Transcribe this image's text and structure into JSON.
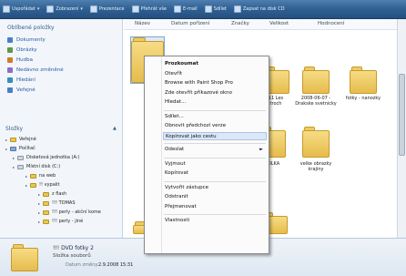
{
  "toolbar": {
    "items": [
      "Uspořádat",
      "Zobrazení",
      "Prezentace",
      "Přehrát vše",
      "E-mail",
      "Sdílet",
      "Zapsat na disk CD"
    ]
  },
  "left_pane": {
    "favorites_heading": "Oblíbené položky",
    "favorites": [
      "Dokumenty",
      "Obrázky",
      "Hudba",
      "Nedávno změněné",
      "Hledání",
      "Veřejné"
    ],
    "tree_heading": "Složky",
    "tree": [
      "Veřejné",
      "Počítač",
      "Disketová jednotka (A:)",
      "Místní disk (C:)",
      "na web",
      "!! vypalit",
      "z flash",
      "!!! TOMAS",
      "!!! perly - akční kome",
      "!!! perly - jiné"
    ]
  },
  "columns": [
    "Název",
    "Datum pořízení",
    "Značky",
    "Velikost",
    "Hodnocení"
  ],
  "files": [
    {
      "label": "11 Les\ntroch",
      "variant": "photo"
    },
    {
      "label": "2008-06-07 -\nDrakske svetnicky",
      "variant": "photo"
    },
    {
      "label": "fotky - nanozky",
      "variant": "photo"
    },
    {
      "label": "KOLKA",
      "variant": "plain"
    },
    {
      "label": "velke obrazky\nkrajiny",
      "variant": "plain"
    }
  ],
  "context_menu": {
    "items": [
      {
        "label": "Prozkoumat",
        "bold": true
      },
      {
        "label": "Otevřít"
      },
      {
        "label": "Browse with Paint Shop Pro"
      },
      {
        "label": "Zde otevřít příkazové okno"
      },
      {
        "label": "Hledat..."
      },
      {
        "sep": true
      },
      {
        "label": "Sdílet..."
      },
      {
        "label": "Obnovit předchozí verze"
      },
      {
        "label": "Kopírovat jako cestu",
        "highlight": true
      },
      {
        "sep": true
      },
      {
        "label": "Odeslat",
        "submenu": true
      },
      {
        "sep": true
      },
      {
        "label": "Vyjmout"
      },
      {
        "label": "Kopírovat"
      },
      {
        "sep": true
      },
      {
        "label": "Vytvořit zástupce"
      },
      {
        "label": "Odstranit"
      },
      {
        "label": "Přejmenovat"
      },
      {
        "sep": true
      },
      {
        "label": "Vlastnosti"
      }
    ]
  },
  "details": {
    "name": "!!! DVD fotky 2",
    "type": "Složka souborů",
    "date_label": "Datum změny:",
    "date": "2.9.2008 15:31"
  },
  "colors": {
    "toolbar": "#2f5f93",
    "folder": "#e6bc4c",
    "link": "#2a5aa3",
    "menu_highlight": "#dce8f7"
  }
}
